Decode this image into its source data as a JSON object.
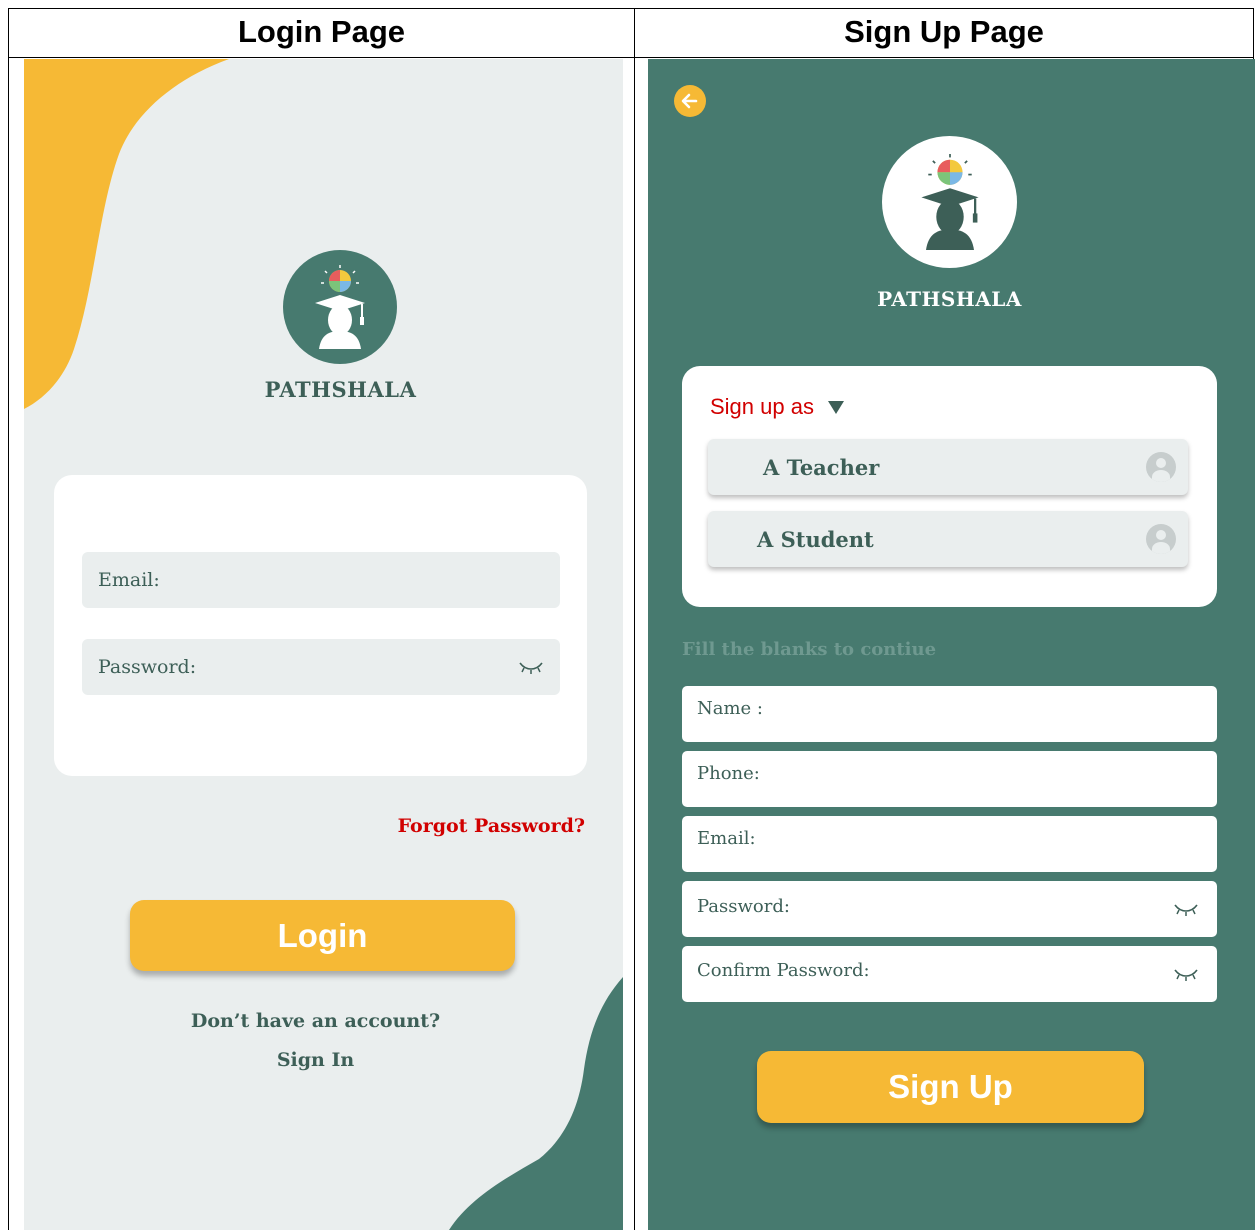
{
  "captions": {
    "login": "Login Page",
    "signup": "Sign Up Page"
  },
  "colors": {
    "teal": "#477a6f",
    "yellow": "#f6b935",
    "light": "#eaeeee",
    "red": "#d10000"
  },
  "login": {
    "brand": "PATHSHALA",
    "email_label": "Email:",
    "password_label": "Password:",
    "forgot_label": "Forgot Password?",
    "login_button": "Login",
    "no_account_text": "Don’t have an account?",
    "sign_in_link": "Sign In"
  },
  "signup": {
    "brand": "PATHSHALA",
    "signup_as_label": "Sign up as",
    "roles": [
      "A Teacher",
      "A Student"
    ],
    "hint": "Fill the blanks to contiue",
    "fields": {
      "name": "Name :",
      "phone": "Phone:",
      "email": "Email:",
      "password": "Password:",
      "confirm_password": "Confirm Password:"
    },
    "signup_button": "Sign Up"
  },
  "icons": [
    "logo-icon",
    "eye-closed-icon",
    "back-arrow-icon",
    "dropdown-triangle-icon",
    "person-icon"
  ]
}
